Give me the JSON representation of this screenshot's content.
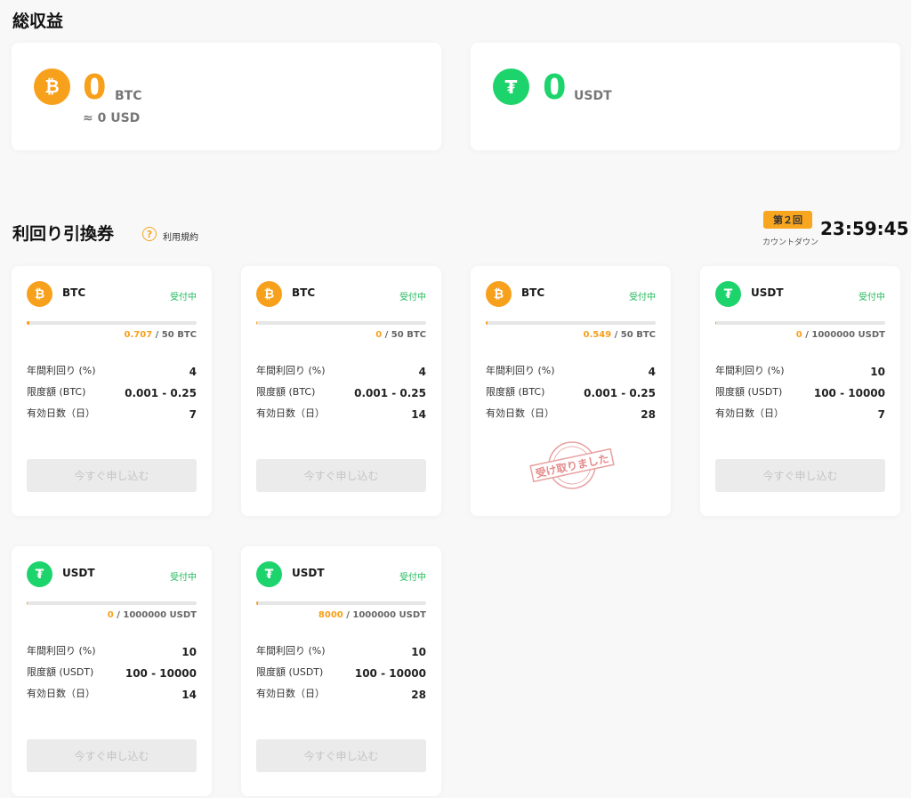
{
  "earnings": {
    "title": "総収益",
    "btc": {
      "value": "0",
      "unit": "BTC",
      "sub": "≈ 0 USD",
      "icon": "bitcoin-icon",
      "color": "#f7a01c"
    },
    "usdt": {
      "value": "0",
      "unit": "USDT",
      "icon": "tether-icon",
      "color": "#1dd36b"
    }
  },
  "vouchers": {
    "title": "利回り引換券",
    "terms_label": "利用規約",
    "help_icon": "?",
    "round_label": "第２回",
    "countdown_label": "カウントダウン",
    "countdown_time": "23:59:45",
    "labels": {
      "yield": "年間利回り (%)",
      "days": "有効日数（日）"
    },
    "apply_label": "今すぐ申し込む",
    "stamp_text": "受け取りました",
    "cards": [
      {
        "coin": "BTC",
        "status": "受付中",
        "current": "0.707",
        "total": "/ 50 BTC",
        "progress": 0.014,
        "yield": "4",
        "limit_label": "限度額 (BTC)",
        "limit": "0.001 - 0.25",
        "days": "7",
        "received": false
      },
      {
        "coin": "BTC",
        "status": "受付中",
        "current": "0",
        "total": "/ 50 BTC",
        "progress": 0,
        "yield": "4",
        "limit_label": "限度額 (BTC)",
        "limit": "0.001 - 0.25",
        "days": "14",
        "received": false
      },
      {
        "coin": "BTC",
        "status": "受付中",
        "current": "0.549",
        "total": "/ 50 BTC",
        "progress": 0.011,
        "yield": "4",
        "limit_label": "限度額 (BTC)",
        "limit": "0.001 - 0.25",
        "days": "28",
        "received": true
      },
      {
        "coin": "USDT",
        "status": "受付中",
        "current": "0",
        "total": "/ 1000000 USDT",
        "progress": 0,
        "yield": "10",
        "limit_label": "限度額 (USDT)",
        "limit": "100 - 10000",
        "days": "7",
        "received": false
      },
      {
        "coin": "USDT",
        "status": "受付中",
        "current": "0",
        "total": "/ 1000000 USDT",
        "progress": 0,
        "yield": "10",
        "limit_label": "限度額 (USDT)",
        "limit": "100 - 10000",
        "days": "14",
        "received": false
      },
      {
        "coin": "USDT",
        "status": "受付中",
        "current": "8000",
        "total": "/ 1000000 USDT",
        "progress": 0.008,
        "yield": "10",
        "limit_label": "限度額 (USDT)",
        "limit": "100 - 10000",
        "days": "28",
        "received": false
      }
    ]
  },
  "colors": {
    "btc": "#f7a01c",
    "usdt": "#1dd36b",
    "status": "#1fba5a",
    "accent": "#f8a51f"
  }
}
